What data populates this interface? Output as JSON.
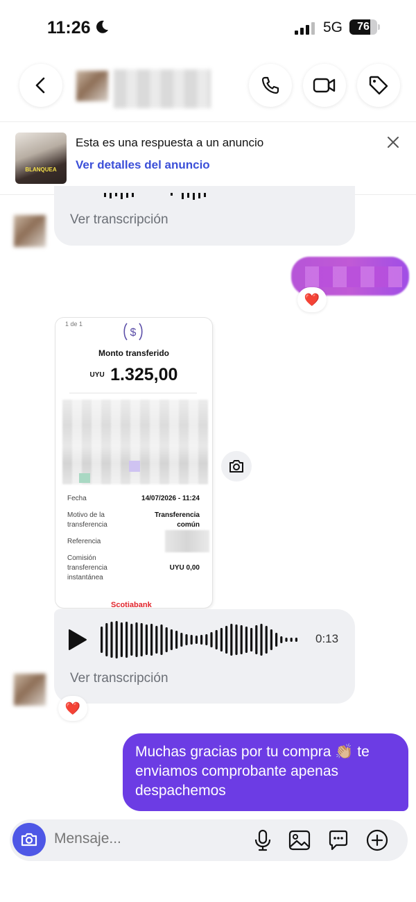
{
  "status_bar": {
    "time": "11:26",
    "network": "5G",
    "battery_percent": "76",
    "battery_level": 0.76,
    "icons": [
      "moon-icon",
      "signal-icon",
      "battery-icon"
    ]
  },
  "header": {
    "icons": [
      "back-icon",
      "phone-icon",
      "video-icon",
      "tag-icon"
    ]
  },
  "ad_banner": {
    "title": "Esta es una respuesta a un anuncio",
    "link": "Ver detalles del anuncio",
    "thumbnail_text": "BLANQUEA"
  },
  "messages": {
    "voice_top_transcript": "Ver transcripción",
    "receipt": {
      "page": "1 de 1",
      "title": "Monto transferido",
      "currency": "UYU",
      "amount": "1.325,00",
      "rows": [
        {
          "label": "Fecha",
          "value": "14/07/2026 - 11:24"
        },
        {
          "label": "Motivo de la transferencia",
          "value": "Transferencia común"
        },
        {
          "label": "Referencia",
          "value": ""
        },
        {
          "label": "Comisión transferencia instantánea",
          "value": "UYU 0,00"
        }
      ],
      "bank": "Scotiabank"
    },
    "voice_main": {
      "duration": "0:13",
      "transcript": "Ver transcripción"
    },
    "outgoing_text": "Muchas gracias por tu compra 👏🏼 te enviamos comprobante apenas despachemos",
    "reaction": "❤️"
  },
  "composer": {
    "placeholder": "Mensaje..."
  },
  "colors": {
    "accent_blue": "#4e57e6",
    "outgoing_bubble": "#6c3ce4",
    "link_blue": "#3b4fd8",
    "bubble_gray": "#eff0f3",
    "heart_red": "#e0262f"
  }
}
